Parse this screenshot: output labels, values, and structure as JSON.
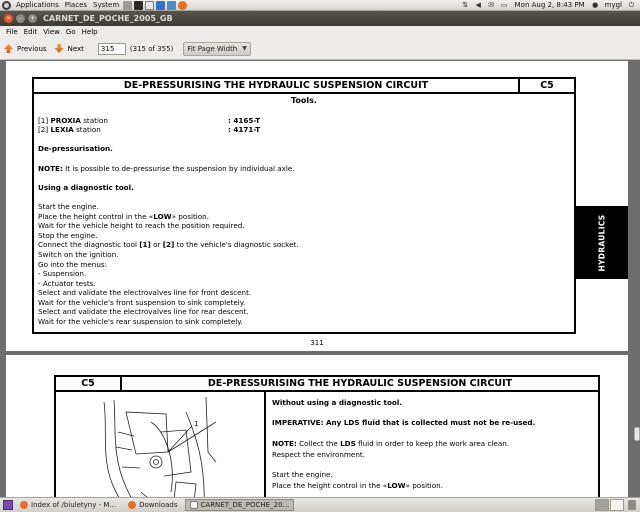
{
  "top_panel": {
    "menus": [
      "Applications",
      "Places",
      "System"
    ],
    "clock": "Mon Aug  2,  8:43 PM",
    "user": "mygl"
  },
  "window": {
    "title": "CARNET_DE_POCHE_2005_GB"
  },
  "menubar": [
    "File",
    "Edit",
    "View",
    "Go",
    "Help"
  ],
  "toolbar": {
    "previous_label": "Previous",
    "next_label": "Next",
    "page_value": "315",
    "page_count": "(315 of 355)",
    "zoom_label": "Fit Page Width"
  },
  "page1": {
    "header_title": "DE-PRESSURISING THE HYDRAULIC SUSPENSION CIRCUIT",
    "header_code": "C5",
    "tools_heading": "Tools.",
    "tool1_prefix": "[1] ",
    "tool1_bold": "PROXIA",
    "tool1_suffix": " station",
    "tool1_value": ": 4165-T",
    "tool2_prefix": "[2] ",
    "tool2_bold": "LEXIA",
    "tool2_suffix": " station",
    "tool2_value": ": 4171-T",
    "depress_heading": "De-pressurisation.",
    "note_label": "NOTE:",
    "note_text": " It is possible to de-pressurise the suspension by individual axle.",
    "diag_heading": "Using a diagnostic tool.",
    "step1": "Start the engine.",
    "step2_a": "Place the height control in the «",
    "step2_b": "LOW",
    "step2_c": "» position.",
    "step3": "Wait for the vehicle height to reach the position required.",
    "step4": "Stop the engine.",
    "step5_a": "Connect the diagnostic tool ",
    "step5_b": "[1]",
    "step5_c": " or ",
    "step5_d": "[2]",
    "step5_e": " to the vehicle's diagnostic socket.",
    "step6": "Switch on the ignition.",
    "step7": "Go into the menus:",
    "step8": " - Suspension.",
    "step9": " - Actuator tests.",
    "step10": "Select and validate the electrovalves line for front descent.",
    "step11": "Wait for the vehicle's front suspension to sink completely.",
    "step12": "Select and validate the electrovalves line for rear descent.",
    "step13": "Wait for the vehicle's rear suspension to sink completely.",
    "side_tab": "HYDRAULICS",
    "page_number": "311"
  },
  "page2": {
    "header_code": "C5",
    "header_title": "DE-PRESSURISING THE HYDRAULIC SUSPENSION CIRCUIT",
    "callout": "1",
    "heading": "Without using a diagnostic tool.",
    "imperative": "IMPERATIVE: Any LDS fluid that is collected must not be re-used.",
    "note_label": "NOTE:",
    "note_a": " Collect the ",
    "note_b": "LDS",
    "note_c": " fluid in order to keep the work area clean.",
    "respect": "Respect the environment.",
    "step1": "Start the engine.",
    "step2_a": "Place the height control in the «",
    "step2_b": "LOW",
    "step2_c": "» position."
  },
  "taskbar": {
    "tasks": [
      "Index of /biuletyny - M...",
      "Downloads",
      "CARNET_DE_POCHE_20..."
    ]
  },
  "colors": {
    "panel": "#d8d6d1",
    "titlebar": "#3c3b37",
    "close_button": "#e9552a",
    "toolbar_arrow": "#e2762a",
    "doc_background": "#6d6d6d"
  }
}
